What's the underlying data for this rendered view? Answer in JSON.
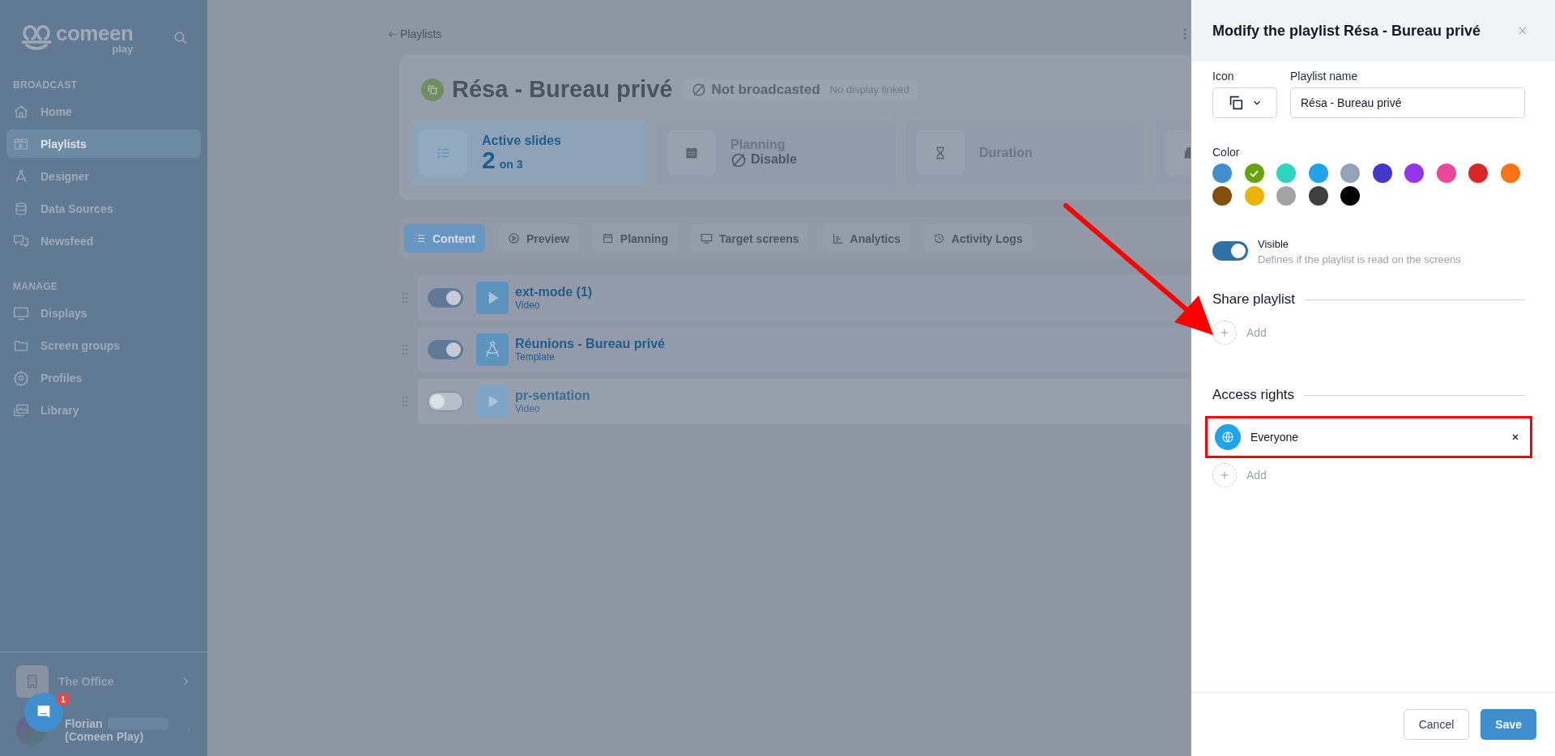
{
  "sidebar": {
    "logo": {
      "name": "comeen",
      "sub": "play"
    },
    "sections": [
      {
        "title": "BROADCAST",
        "items": [
          {
            "label": "Home",
            "selected": false
          },
          {
            "label": "Playlists",
            "selected": true
          },
          {
            "label": "Designer",
            "selected": false
          },
          {
            "label": "Data Sources",
            "selected": false
          },
          {
            "label": "Newsfeed",
            "selected": false
          }
        ]
      },
      {
        "title": "MANAGE",
        "items": [
          {
            "label": "Displays",
            "selected": false
          },
          {
            "label": "Screen groups",
            "selected": false
          },
          {
            "label": "Profiles",
            "selected": false
          },
          {
            "label": "Library",
            "selected": false
          }
        ]
      }
    ],
    "workspace": "The Office",
    "user": {
      "name": "Florian",
      "org": "(Comeen Play)"
    },
    "chat_badge": "1"
  },
  "main": {
    "back": "Playlists",
    "title": "Résa - Bureau privé",
    "status": "Not broadcasted",
    "status_note": "No display linked",
    "stats": [
      {
        "kind": "count",
        "label": "Active slides",
        "value": "2",
        "suffix": "on 3",
        "selected": true
      },
      {
        "kind": "status",
        "label": "Planning",
        "value": "Disable",
        "selected": false
      },
      {
        "kind": "label",
        "label": "Duration",
        "selected": false
      },
      {
        "kind": "icon",
        "selected": false
      }
    ],
    "tabs": [
      {
        "label": "Content",
        "selected": true
      },
      {
        "label": "Preview",
        "selected": false
      },
      {
        "label": "Planning",
        "selected": false
      },
      {
        "label": "Target screens",
        "selected": false
      },
      {
        "label": "Analytics",
        "selected": false
      },
      {
        "label": "Activity Logs",
        "selected": false
      }
    ],
    "slides": [
      {
        "kind": "video",
        "title": "ext-mode (1)",
        "type": "Video",
        "enabled": true
      },
      {
        "kind": "template",
        "title": "Réunions - Bureau privé",
        "type": "Template",
        "enabled": true
      },
      {
        "kind": "video",
        "title": "pr-sentation",
        "type": "Video",
        "enabled": false
      }
    ]
  },
  "panel": {
    "title": "Modify the playlist Résa - Bureau privé",
    "icon_label": "Icon",
    "name_label": "Playlist name",
    "name_value": "Résa - Bureau privé",
    "color_label": "Color",
    "colors": [
      {
        "color": "#3f8fcf",
        "selected": false
      },
      {
        "color": "#65a30d",
        "selected": true
      },
      {
        "color": "#2dd4bf",
        "selected": false
      },
      {
        "color": "#1ea4e9",
        "selected": false
      },
      {
        "color": "#94a3b8",
        "selected": false
      },
      {
        "color": "#4338ca",
        "selected": false
      },
      {
        "color": "#9333ea",
        "selected": false
      },
      {
        "color": "#ec4899",
        "selected": false
      },
      {
        "color": "#dc2626",
        "selected": false
      },
      {
        "color": "#f97316",
        "selected": false
      },
      {
        "color": "#854d0e",
        "selected": false
      },
      {
        "color": "#eab308",
        "selected": false
      },
      {
        "color": "#a3a3a3",
        "selected": false
      },
      {
        "color": "#404040",
        "selected": false
      },
      {
        "color": "#000000",
        "selected": false
      }
    ],
    "visible": {
      "label": "Visible",
      "description": "Defines if the playlist is read on the screens",
      "on": true
    },
    "share": {
      "title": "Share playlist",
      "add": "Add"
    },
    "access": {
      "title": "Access rights",
      "items": [
        {
          "label": "Everyone",
          "highlighted": true
        }
      ],
      "add": "Add"
    },
    "buttons": {
      "cancel": "Cancel",
      "save": "Save"
    }
  }
}
